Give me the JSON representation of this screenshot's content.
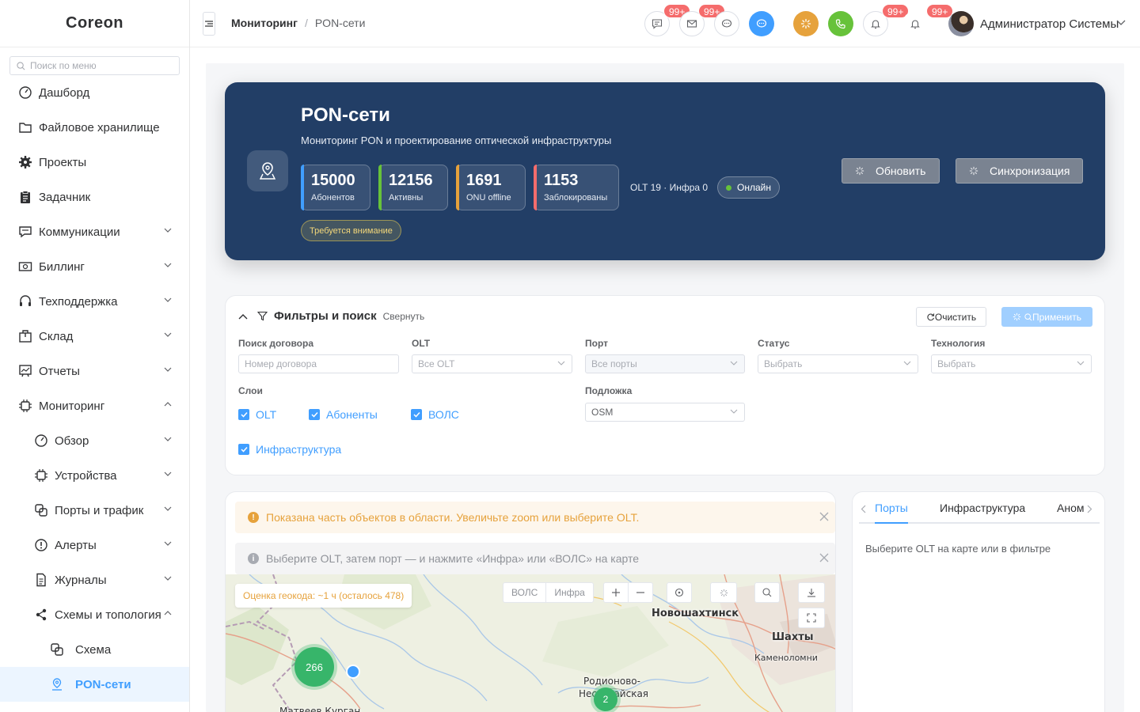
{
  "app": {
    "logo": "Coreon"
  },
  "menu_search": {
    "placeholder": "Поиск по меню"
  },
  "menu": {
    "dashboard": "Дашборд",
    "files": "Файловое хранилище",
    "projects": "Проекты",
    "tasks": "Задачник",
    "communications": "Коммуникации",
    "billing": "Биллинг",
    "support": "Техподдержка",
    "warehouse": "Склад",
    "reports": "Отчеты",
    "monitoring": "Мониторинг",
    "overview": "Обзор",
    "devices": "Устройства",
    "ports_traffic": "Порты и трафик",
    "alerts": "Алерты",
    "logs": "Журналы",
    "schemes": "Схемы и топология",
    "scheme": "Схема",
    "pon": "PON-сети"
  },
  "header": {
    "breadcrumb_parent": "Мониторинг",
    "breadcrumb_sep": "/",
    "breadcrumb_current": "PON-сети",
    "badges": [
      "99+",
      "99+",
      "99+",
      "99+"
    ],
    "username": "Администратор Системы",
    "colors": {
      "chat": "#409eff",
      "orange": "#e6a23c",
      "green": "#67c23a"
    }
  },
  "hero": {
    "title": "PON-сети",
    "subtitle": "Мониторинг PON и проектирование оптической инфраструктуры",
    "stats": [
      {
        "value": "15000",
        "label": "Абонентов",
        "color": "#409eff"
      },
      {
        "value": "12156",
        "label": "Активны",
        "color": "#67c23a"
      },
      {
        "value": "1691",
        "label": "ONU offline",
        "color": "#e6a23c"
      },
      {
        "value": "1153",
        "label": "Заблокированы",
        "color": "#f56c6c"
      }
    ],
    "olt_info": "OLT 19 · Инфра 0",
    "status": "Онлайн",
    "attention": "Требуется внимание",
    "refresh_label": "Обновить",
    "sync_label": "Синхронизация"
  },
  "filters": {
    "title": "Фильтры и поиск",
    "collapse": "Свернуть",
    "clear": "Очистить",
    "apply": "Применить",
    "contract_label": "Поиск договора",
    "contract_placeholder": "Номер договора",
    "olt_label": "OLT",
    "olt_value": "Все OLT",
    "port_label": "Порт",
    "port_value": "Все порты",
    "status_label": "Статус",
    "status_placeholder": "Выбрать",
    "tech_label": "Технология",
    "tech_placeholder": "Выбрать",
    "layers_label": "Слои",
    "layers": [
      {
        "label": "OLT",
        "checked": true
      },
      {
        "label": "Абоненты",
        "checked": true
      },
      {
        "label": "ВОЛС",
        "checked": true
      },
      {
        "label": "Инфраструктура",
        "checked": true
      }
    ],
    "basemap_label": "Подложка",
    "basemap_value": "OSM"
  },
  "map": {
    "warning": "Показана часть объектов в области. Увеличьте zoom или выберите OLT.",
    "info": "Выберите OLT, затем порт — и нажмите «Инфра» или «ВОЛС» на карте",
    "geocode": "Оценка геокода: ~1 ч (осталось 478)",
    "btn_vols": "ВОЛС",
    "btn_infra": "Инфра",
    "cities": [
      "Новошахтинск",
      "Шахты",
      "Каменоломни",
      "Родионово-",
      "Несветайская",
      "Матвеев Курган"
    ],
    "clusters": [
      "266",
      "2"
    ]
  },
  "side": {
    "tabs": [
      "Порты",
      "Инфраструктура",
      "Аном"
    ],
    "empty": "Выберите OLT на карте или в фильтре"
  }
}
